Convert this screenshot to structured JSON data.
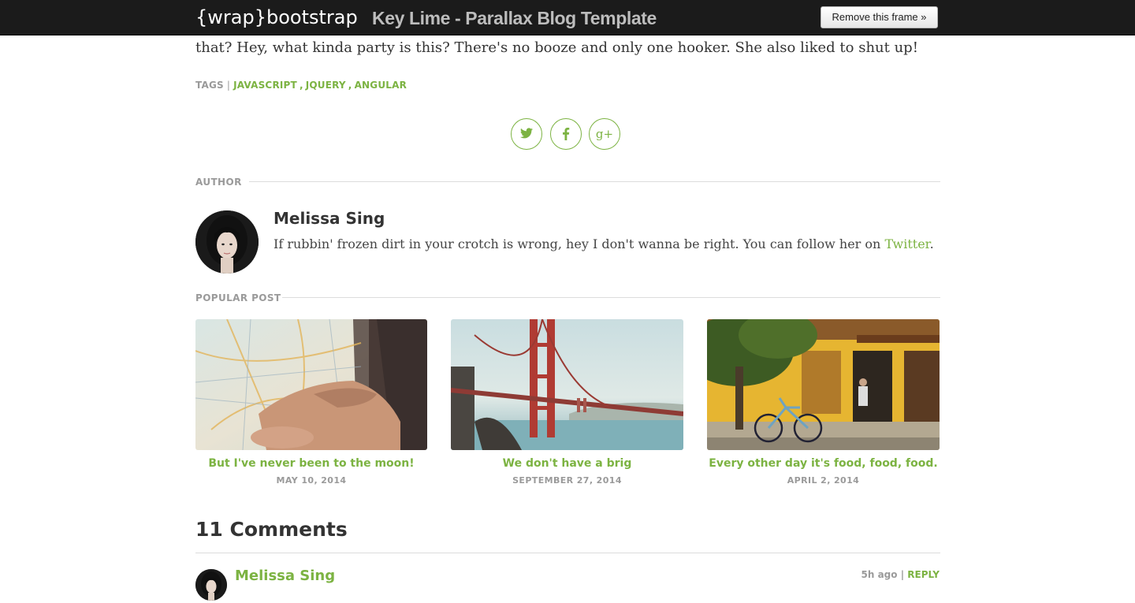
{
  "topbar": {
    "brand_open": "{",
    "brand_word": "wrap",
    "brand_close": "}",
    "brand_rest": "bootstrap",
    "template_title": "Key Lime - Parallax Blog Template",
    "remove_button": "Remove this frame »"
  },
  "article": {
    "intro_text": "that? Hey, what kinda party is this? There's no booze and only one hooker. She also liked to shut up!"
  },
  "tags": {
    "label": "TAGS",
    "separator": "|",
    "items": [
      "JAVASCRIPT",
      "JQUERY",
      "ANGULAR"
    ]
  },
  "share": {
    "icons": [
      "twitter-icon",
      "facebook-icon",
      "google-plus-icon"
    ],
    "google_plus_text": "g+"
  },
  "author": {
    "section_label": "AUTHOR",
    "name": "Melissa Sing",
    "bio_text": "If rubbin' frozen dirt in your crotch is wrong, hey I don't wanna be right. You can follow her on ",
    "bio_link": "Twitter",
    "bio_end": "."
  },
  "popular": {
    "section_label": "POPULAR POST",
    "posts": [
      {
        "title": "But I've never been to the moon!",
        "date": "MAY 10, 2014",
        "image": "map-in-hand-photo"
      },
      {
        "title": "We don't have a brig",
        "date": "SEPTEMBER 27, 2014",
        "image": "golden-gate-bridge-photo"
      },
      {
        "title": "Every other day it's food, food, food.",
        "date": "APRIL 2, 2014",
        "image": "yellow-house-bicycle-photo"
      }
    ]
  },
  "comments": {
    "title": "11 Comments",
    "first": {
      "author": "Melissa Sing",
      "time": "5h ago",
      "separator": "|",
      "reply": "REPLY"
    }
  },
  "colors": {
    "accent": "#7cb342",
    "topbar_bg": "#1b1b1b",
    "muted": "#9a9a9a"
  }
}
